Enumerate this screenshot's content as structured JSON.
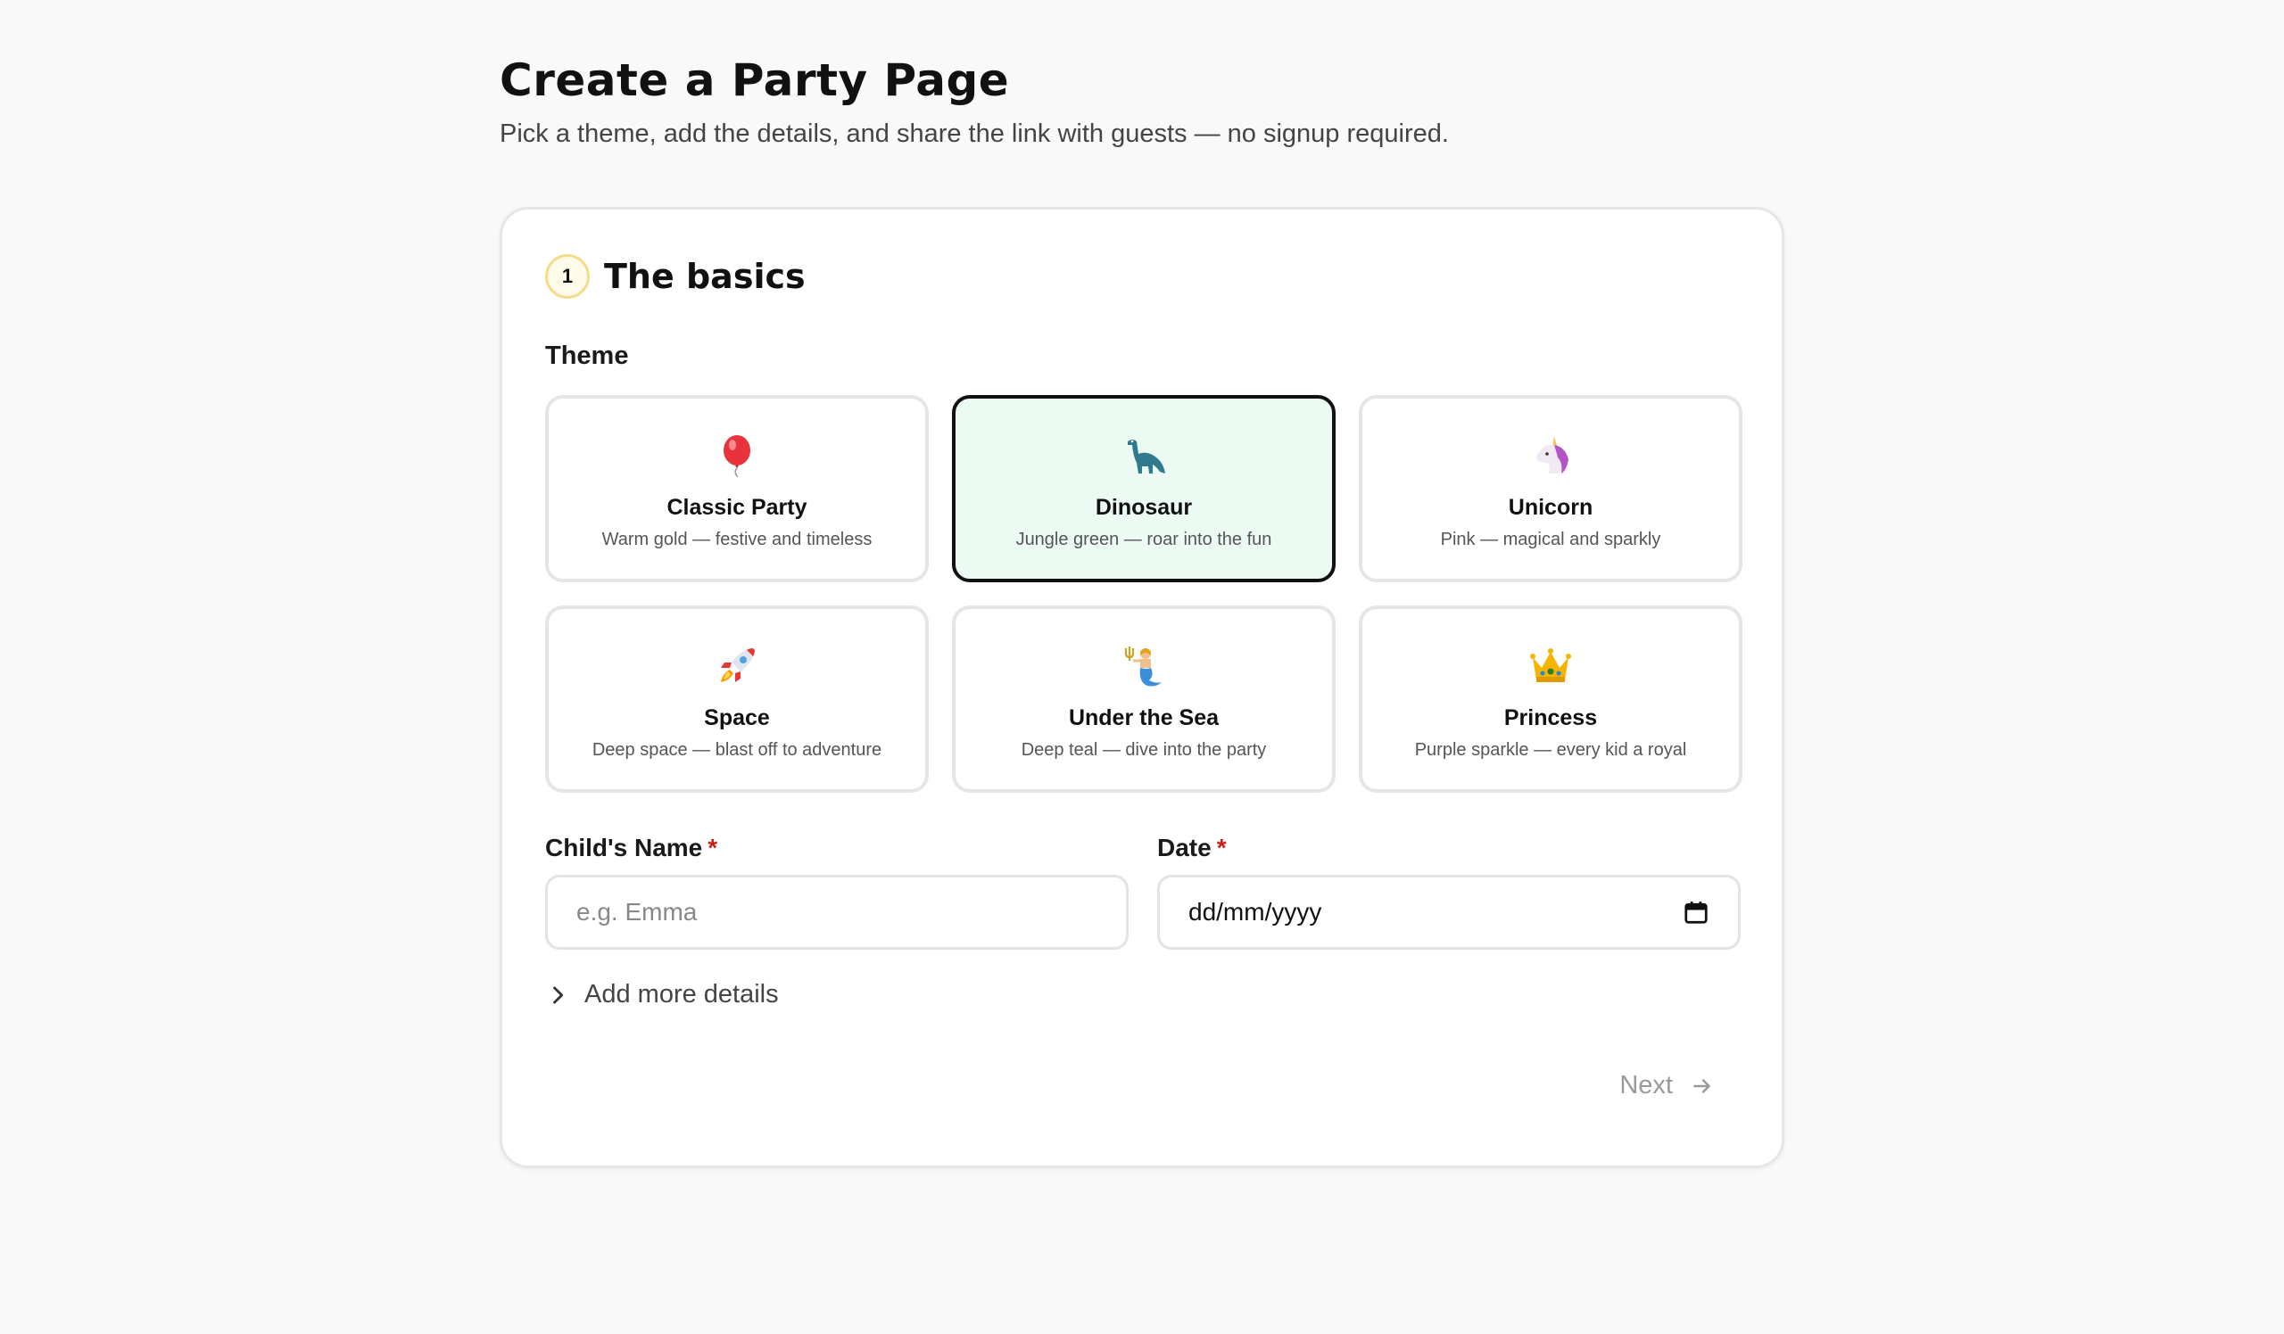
{
  "header": {
    "title": "Create a Party Page",
    "subtitle": "Pick a theme, add the details, and share the link with guests — no signup required."
  },
  "step": {
    "number": "1",
    "title": "The basics"
  },
  "theme_section": {
    "label": "Theme",
    "selected": "Dinosaur",
    "options": [
      {
        "name": "Classic Party",
        "desc": "Warm gold — festive and timeless",
        "icon": "balloon-icon"
      },
      {
        "name": "Dinosaur",
        "desc": "Jungle green — roar into the fun",
        "icon": "dinosaur-icon"
      },
      {
        "name": "Unicorn",
        "desc": "Pink — magical and sparkly",
        "icon": "unicorn-icon"
      },
      {
        "name": "Space",
        "desc": "Deep space — blast off to adventure",
        "icon": "rocket-icon"
      },
      {
        "name": "Under the Sea",
        "desc": "Deep teal — dive into the party",
        "icon": "merperson-icon"
      },
      {
        "name": "Princess",
        "desc": "Purple sparkle — every kid a royal",
        "icon": "crown-icon"
      }
    ]
  },
  "fields": {
    "child_name": {
      "label": "Child's Name",
      "required_mark": "*",
      "placeholder": "e.g. Emma",
      "value": ""
    },
    "date": {
      "label": "Date",
      "required_mark": "*",
      "value": "dd/mm/yyyy"
    }
  },
  "more_details_label": "Add more details",
  "next_label": "Next",
  "colors": {
    "selected_bg": "#ebfbf3",
    "badge_border": "#f6dc8a",
    "required": "#c81e1e"
  }
}
